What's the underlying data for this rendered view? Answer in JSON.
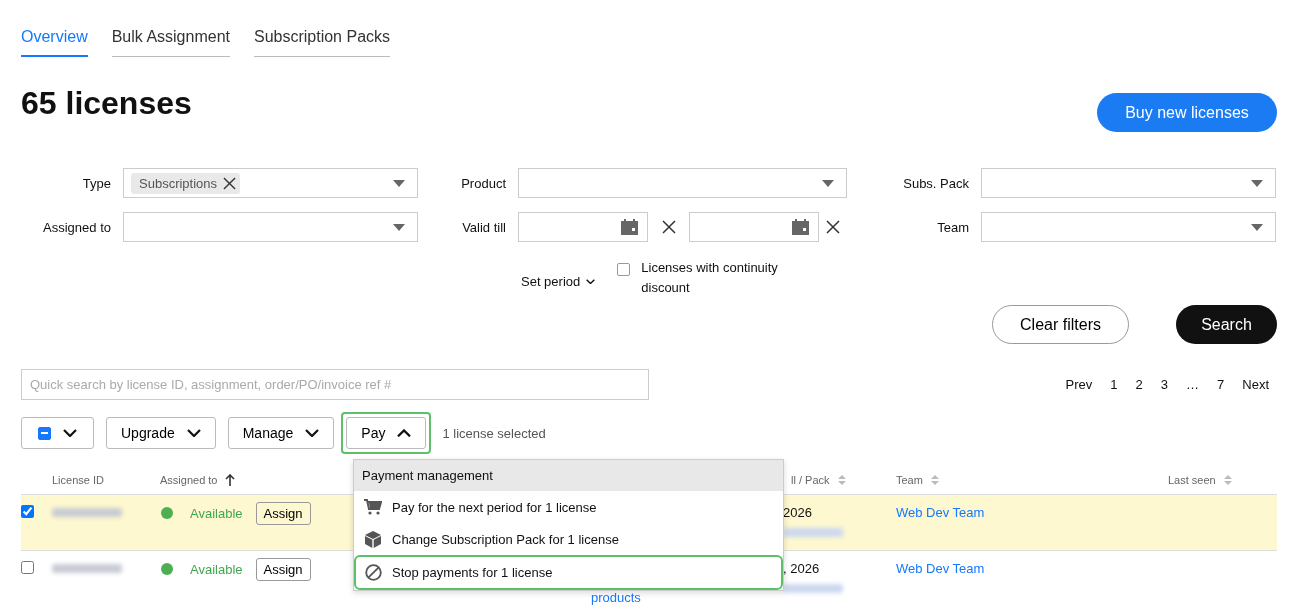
{
  "tabs": [
    {
      "label": "Overview",
      "selected": true
    },
    {
      "label": "Bulk Assignment",
      "selected": false
    },
    {
      "label": "Subscription Packs",
      "selected": false
    }
  ],
  "title": "65 licenses",
  "buy_button": "Buy new licenses",
  "filters": [
    {
      "label": "Type",
      "kind": "select",
      "chips": [
        "Subscriptions"
      ]
    },
    {
      "label": "Product",
      "kind": "select"
    },
    {
      "label": "Subs. Pack",
      "kind": "select"
    },
    {
      "label": "Assigned to",
      "kind": "select"
    },
    {
      "label": "Valid till",
      "kind": "date_range"
    },
    {
      "label": "Team",
      "kind": "select"
    }
  ],
  "set_period": "Set period",
  "continuity": {
    "label": "Licenses with continuity discount",
    "checked": false
  },
  "clear_button": "Clear filters",
  "search_button": "Search",
  "quick_search": {
    "placeholder": "Quick search by license ID, assignment, order/PO/invoice ref #"
  },
  "pagination": [
    "Prev",
    "1",
    "2",
    "3",
    "…",
    "7",
    "Next"
  ],
  "toolbar": {
    "select_all": {
      "partial": true
    },
    "buttons": [
      {
        "label": "Upgrade",
        "expanded": false,
        "highlighted": false
      },
      {
        "label": "Manage",
        "expanded": false,
        "highlighted": false
      },
      {
        "label": "Pay",
        "expanded": true,
        "highlighted": true
      }
    ],
    "selection_text": "1 license selected"
  },
  "menu": {
    "header": "Payment management",
    "items": [
      {
        "label": "Pay for the next period for 1 license",
        "kind": "cart",
        "highlighted": false
      },
      {
        "label": "Change Subscription Pack for 1 license",
        "kind": "cube",
        "highlighted": false
      },
      {
        "label": "Stop payments for 1 license",
        "kind": "stop",
        "highlighted": true
      }
    ]
  },
  "table": {
    "columns": [
      {
        "label": "License ID",
        "sortable": false
      },
      {
        "label": "Assigned to",
        "sortable": true,
        "sorted_ascending": true
      },
      {
        "label": "ll / Pack",
        "sortable": true,
        "sorted_ascending": false
      },
      {
        "label": "Team",
        "sortable": true,
        "sorted_ascending": false
      },
      {
        "label": "Last seen",
        "sortable": true,
        "sorted_ascending": false
      }
    ],
    "rows": [
      {
        "checked": true,
        "status": "Available",
        "action": "Assign",
        "valid": "2026",
        "team": "Web Dev Team"
      },
      {
        "checked": false,
        "status": "Available",
        "action": "Assign",
        "products": "products",
        "valid": ", 2026",
        "team": "Web Dev Team"
      }
    ]
  }
}
